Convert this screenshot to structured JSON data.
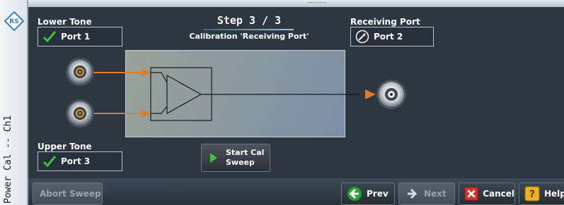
{
  "sidebar": {
    "label": "Power Cal -- Ch1"
  },
  "step": {
    "title": "Step 3 / 3",
    "subtitle": "Calibration 'Receiving Port'"
  },
  "lower_tone": {
    "header": "Lower Tone",
    "port": "Port 1"
  },
  "upper_tone": {
    "header": "Upper Tone",
    "port": "Port 3"
  },
  "receiving_port": {
    "header": "Receiving Port",
    "port": "Port 2"
  },
  "start_button": {
    "label_line1": "Start Cal",
    "label_line2": "Sweep"
  },
  "bottom": {
    "abort": "Abort Sweep",
    "prev": "Prev",
    "next": "Next",
    "cancel": "Cancel",
    "help": "Help"
  },
  "colors": {
    "arrow": "#e07b2e",
    "check": "#3ec13e",
    "background": "#2c3742"
  }
}
